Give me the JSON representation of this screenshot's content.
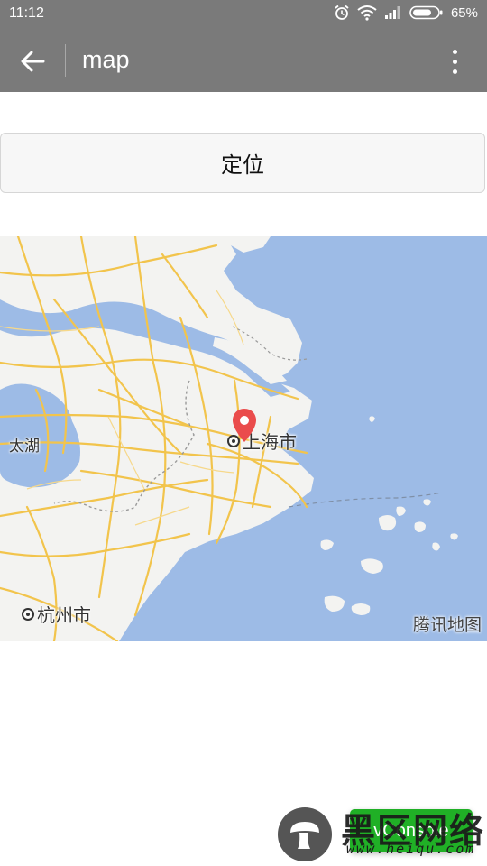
{
  "status_bar": {
    "time": "11:12",
    "battery_percent": "65%",
    "icons": [
      "alarm-icon",
      "wifi-icon",
      "signal-icon",
      "battery-icon"
    ]
  },
  "app_bar": {
    "title": "map",
    "back_icon": "arrow-left-icon",
    "menu_icon": "more-vertical-icon",
    "background": "#7a7a7a"
  },
  "locate_button": {
    "label": "定位"
  },
  "map": {
    "labels": {
      "lake": "太湖",
      "shanghai": "上海市",
      "hangzhou": "杭州市"
    },
    "watermark": "腾讯地图",
    "pin_icon": "map-pin-icon",
    "water_color": "#9dbbe6",
    "land_color": "#f3f3f1",
    "road_color": "#f2c44c"
  },
  "vconsole": {
    "label": "vConsole",
    "color": "#20b026"
  },
  "site_watermark": {
    "text": "黑区网络",
    "url": "www.heiqu.com"
  }
}
